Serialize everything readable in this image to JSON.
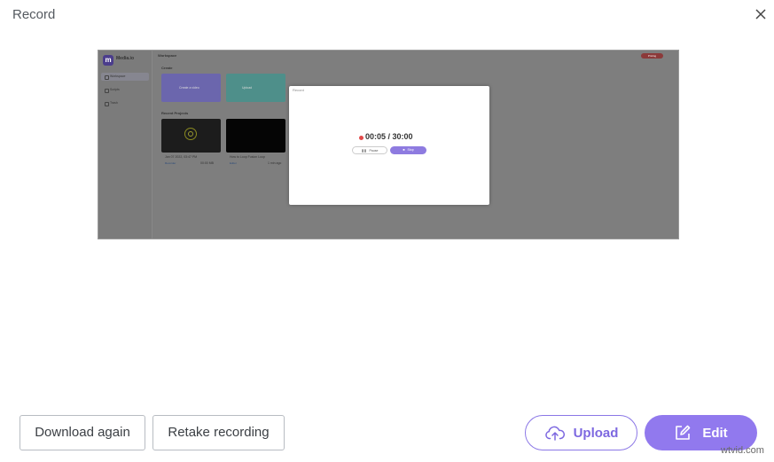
{
  "dialog": {
    "title": "Record",
    "close_icon": "close-icon"
  },
  "preview": {
    "app": {
      "brand": "Media.io",
      "logo_letter": "m",
      "workspace_title": "Workspace",
      "badge": "Pricing",
      "nav": [
        "Workspace",
        "Scripts",
        "Trash"
      ],
      "create_section": "Create",
      "create_cards": [
        {
          "label": "Create a video",
          "color": "#6b66ad"
        },
        {
          "label": "Upload",
          "color": "#4e8f8a"
        }
      ],
      "recent_section": "Recent Projects",
      "recent_items": [
        {
          "title": "Jan 07 2022, 03:47 PM",
          "tag": "Recorder",
          "size": "00:00 MB"
        },
        {
          "title": "How to Loop Fusion Loop",
          "tag": "Editor",
          "size": "1 min ago"
        }
      ]
    },
    "record_modal": {
      "title": "Record",
      "timer": "00:05 / 30:00",
      "pause_label": "Pause",
      "stop_label": "Stop"
    }
  },
  "actions": {
    "download_again": "Download again",
    "retake_recording": "Retake recording",
    "upload": "Upload",
    "edit": "Edit"
  },
  "colors": {
    "accent": "#9179ee",
    "accent_text": "#7d68e0",
    "record_red": "#e24a4a"
  },
  "watermark": "wtvid.com"
}
